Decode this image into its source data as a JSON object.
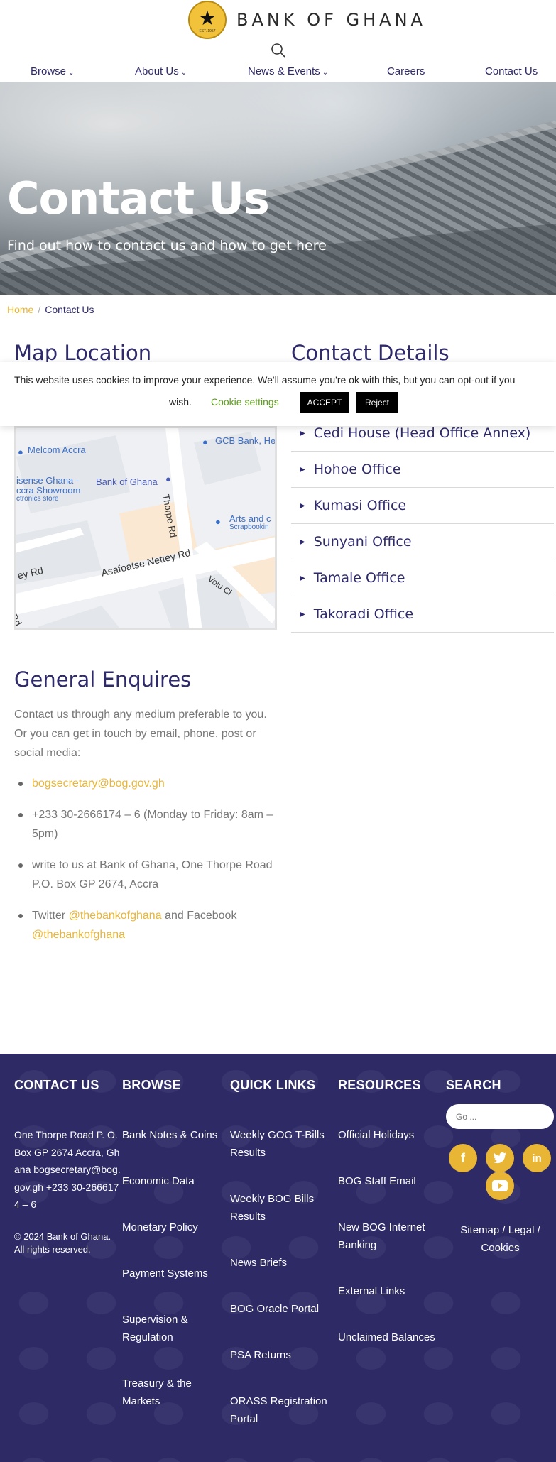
{
  "header": {
    "logo_name": "BANK OF GHANA",
    "logo_seal_text": "EST. 1957",
    "nav": [
      {
        "label": "Browse",
        "has_dropdown": true
      },
      {
        "label": "About Us",
        "has_dropdown": true
      },
      {
        "label": "News & Events",
        "has_dropdown": true
      },
      {
        "label": "Careers",
        "has_dropdown": false
      },
      {
        "label": "Contact Us",
        "has_dropdown": false
      }
    ]
  },
  "hero": {
    "title": "Contact Us",
    "subtitle": "Find out how to contact us and how to get here"
  },
  "breadcrumb": {
    "home": "Home",
    "separator": "/",
    "current": "Contact Us"
  },
  "map_section": {
    "heading": "Map Location",
    "labels": {
      "melcom": "Melcom Accra",
      "gcb": "GCB Bank, He",
      "license": "isense Ghana -",
      "showroom": "ccra Showroom",
      "electronics": "ctronics store",
      "bog": "Bank of Ghana",
      "thorpe": "Thorpe Rd",
      "arts": "Arts and c",
      "scrapbook": "Scrapbookin",
      "asafoatse": "Asafoatse Nettey Rd",
      "ey_rd": "ey Rd",
      "volu": "Volu Cl",
      "rd": "Rd"
    }
  },
  "contact_section": {
    "heading": "Contact Details",
    "offices": [
      "Cedi House (Head Office Annex)",
      "Hohoe Office",
      "Kumasi Office",
      "Sunyani Office",
      "Tamale Office",
      "Takoradi Office"
    ]
  },
  "cookie_banner": {
    "message": "This website uses cookies to improve your experience. We'll assume you're ok with this, but you can opt-out if you",
    "message_end": "wish.",
    "settings_label": "Cookie settings",
    "accept_label": "ACCEPT",
    "reject_label": "Reject"
  },
  "enquiries": {
    "heading": "General Enquires",
    "intro": "Contact us through any medium preferable to you. Or you can get in touch by email, phone, post or social media:",
    "email": "bogsecretary@bog.gov.gh",
    "phone": "+233 30-2666174 – 6 (Monday to Friday: 8am – 5pm)",
    "post": "write to us at Bank of Ghana, One Thorpe Road P.O. Box GP 2674, Accra",
    "social_prefix": "Twitter",
    "twitter_handle": "@thebankofghana",
    "social_mid": "and Facebook",
    "facebook_handle": "@thebankofghana"
  },
  "footer": {
    "contact": {
      "heading": "CONTACT US",
      "address": "One Thorpe Road P. O. Box GP 2674 Accra, Ghana bogsecretary@bog.gov.gh +233 30-2666174 – 6",
      "copyright": "© 2024 Bank of Ghana. All rights reserved."
    },
    "browse": {
      "heading": "BROWSE",
      "links": [
        "Bank Notes & Coins",
        "Economic Data",
        "Monetary Policy",
        "Payment Systems",
        "Supervision & Regulation",
        "Treasury & the Markets"
      ]
    },
    "quick_links": {
      "heading": "QUICK LINKS",
      "links": [
        "Weekly GOG T-Bills Results",
        "Weekly BOG Bills Results",
        "News Briefs",
        "BOG Oracle Portal",
        "PSA Returns",
        "ORASS Registration Portal"
      ]
    },
    "resources": {
      "heading": "RESOURCES",
      "links": [
        "Official Holidays",
        "BOG Staff Email",
        "New BOG Internet Banking",
        "External Links",
        "Unclaimed Balances"
      ]
    },
    "search": {
      "heading": "SEARCH",
      "placeholder": "Go ..."
    },
    "social": [
      "facebook",
      "twitter",
      "linkedin",
      "youtube"
    ],
    "sitemap": "Sitemap / Legal / Cookies"
  },
  "colors": {
    "brand_navy": "#2d2a66",
    "brand_gold": "#e9b535",
    "cookie_link": "#5e9c1d"
  }
}
